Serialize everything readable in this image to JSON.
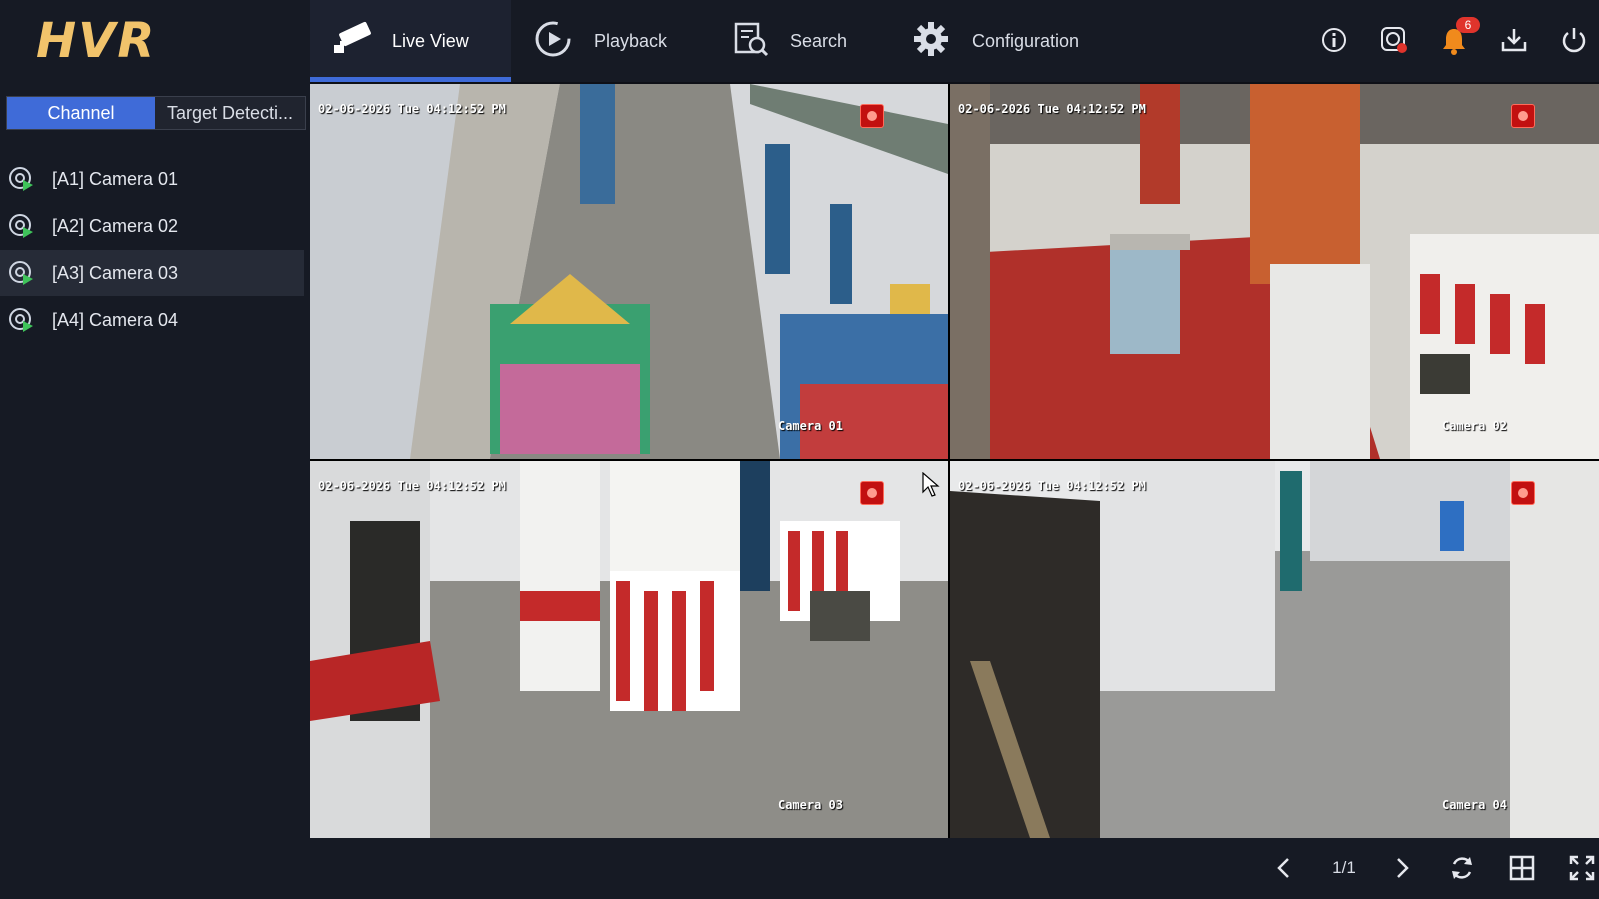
{
  "app": {
    "logo_text": "HVR"
  },
  "nav": {
    "tabs": [
      {
        "label": "Live View",
        "icon": "camera-icon",
        "active": true
      },
      {
        "label": "Playback",
        "icon": "playback-icon",
        "active": false
      },
      {
        "label": "Search",
        "icon": "search-file-icon",
        "active": false
      },
      {
        "label": "Configuration",
        "icon": "gear-icon",
        "active": false
      }
    ],
    "right_icons": [
      "info-icon",
      "record-status-icon",
      "alarm-bell-icon",
      "download-icon",
      "power-icon"
    ],
    "alarm_count": "6"
  },
  "sidebar": {
    "subtabs": [
      {
        "label": "Channel",
        "active": true
      },
      {
        "label": "Target Detecti...",
        "active": false
      }
    ],
    "cameras": [
      {
        "label": "[A1] Camera 01",
        "selected": false
      },
      {
        "label": "[A2] Camera 02",
        "selected": false
      },
      {
        "label": "[A3] Camera 03",
        "selected": true
      },
      {
        "label": "[A4] Camera 04",
        "selected": false
      }
    ]
  },
  "tiles": [
    {
      "timestamp": "02-06-2026 Tue 04:12:52 PM",
      "osd_name": "Camera 01",
      "recording": true,
      "selected": false
    },
    {
      "timestamp": "02-06-2026 Tue 04:12:52 PM",
      "osd_name": "Camera 02",
      "recording": true,
      "selected": false
    },
    {
      "timestamp": "02-06-2026 Tue 04:12:52 PM",
      "osd_name": "Camera 03",
      "recording": true,
      "selected": true
    },
    {
      "timestamp": "02-06-2026 Tue 04:12:52 PM",
      "osd_name": "Camera 04",
      "recording": true,
      "selected": false
    }
  ],
  "footer": {
    "page_indicator": "1/1",
    "icons": [
      "prev-page-icon",
      "next-page-icon",
      "refresh-icon",
      "layout-grid-icon",
      "fullscreen-icon"
    ]
  },
  "colors": {
    "accent": "#3f6bd8",
    "logo": "#f1c36b",
    "background": "#0e1017",
    "panel": "#161a24",
    "alarm": "#e0342c"
  }
}
